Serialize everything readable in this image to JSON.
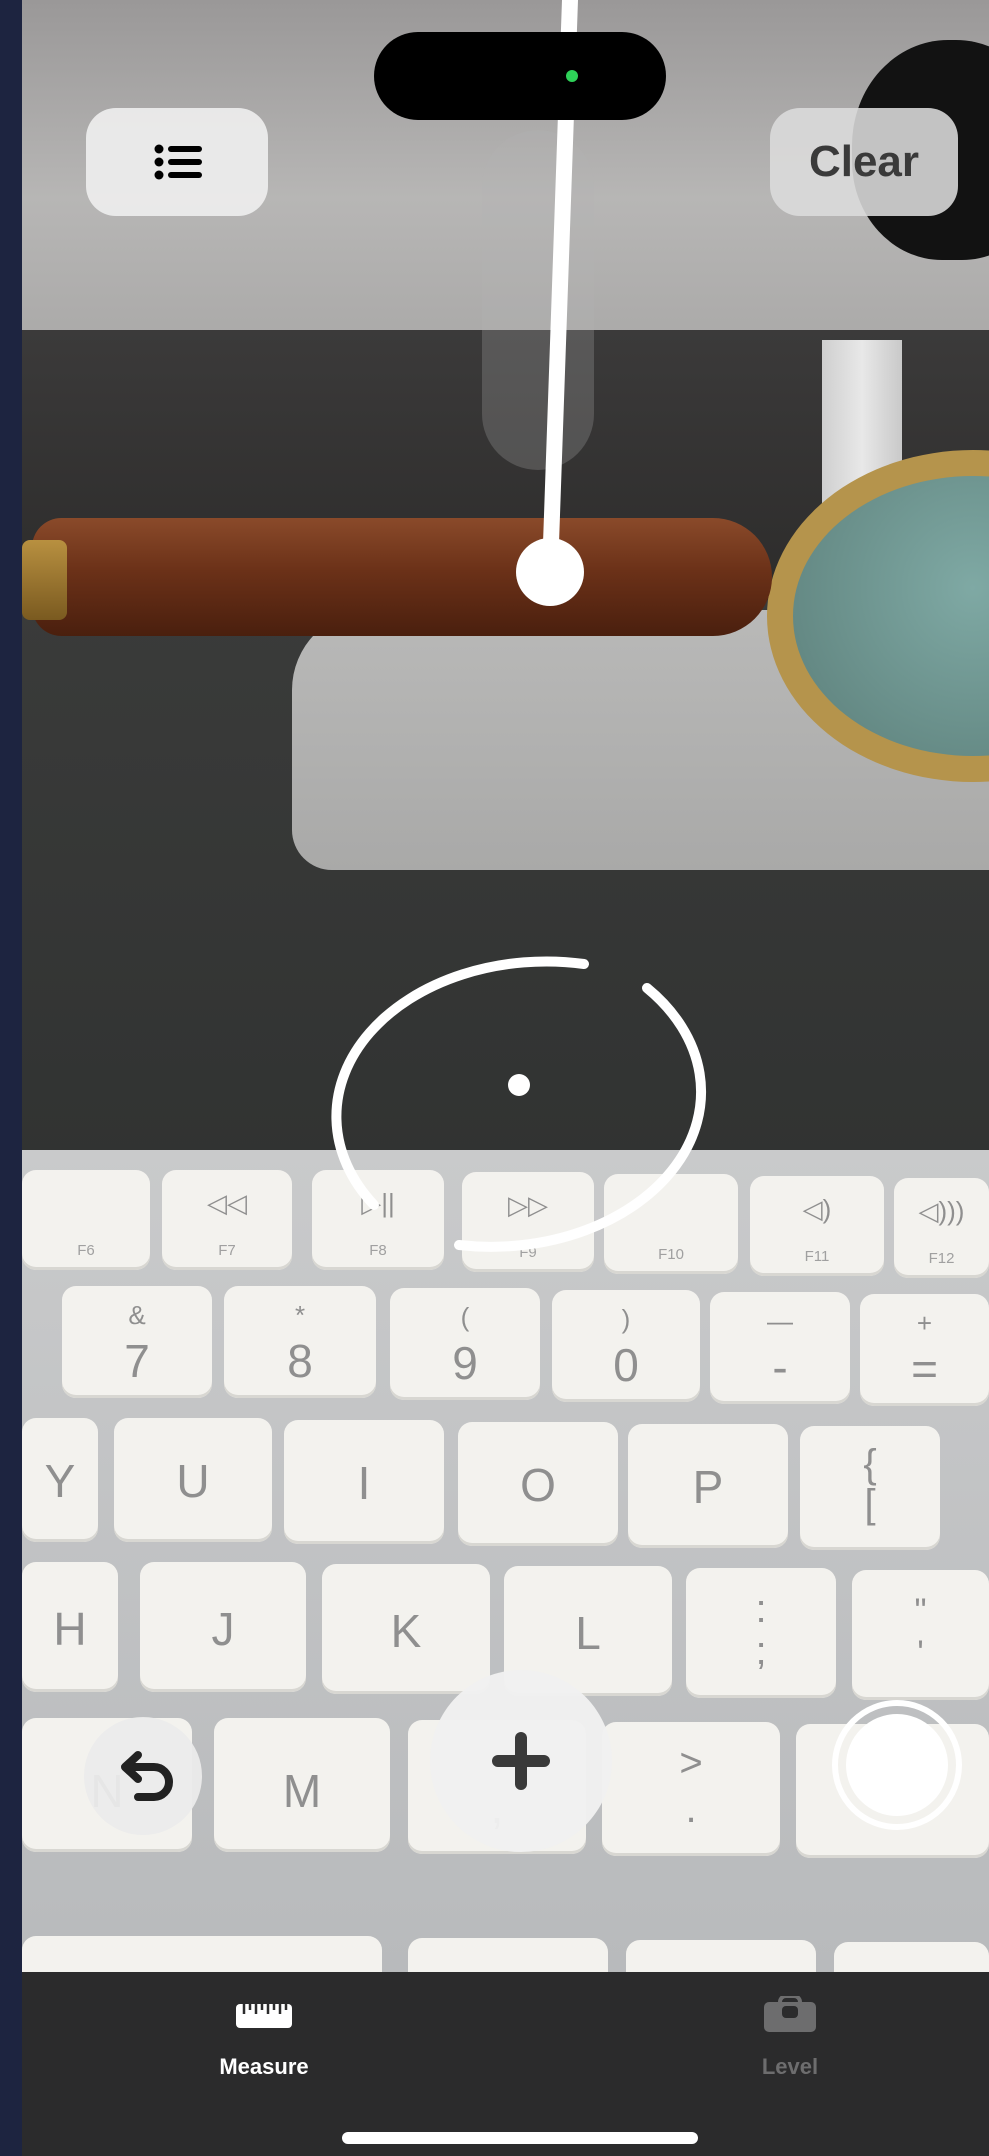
{
  "toolbar": {
    "list_icon": "list-bullet-icon",
    "clear_label": "Clear"
  },
  "status": {
    "camera_indicator_color": "#2ed158"
  },
  "reticle": {
    "icon": "focus-reticle-icon"
  },
  "keyboard": {
    "fn_row": [
      {
        "top": "",
        "bottom": "F6"
      },
      {
        "top": "◁◁",
        "bottom": "F7"
      },
      {
        "top": "▷||",
        "bottom": "F8"
      },
      {
        "top": "▷▷",
        "bottom": "F9"
      },
      {
        "top": "",
        "bottom": "F10"
      },
      {
        "top": "◁)",
        "bottom": "F11"
      },
      {
        "top": "◁)))",
        "bottom": "F12"
      }
    ],
    "num_row": [
      {
        "top": "&",
        "bottom": "7"
      },
      {
        "top": "*",
        "bottom": "8"
      },
      {
        "top": "(",
        "bottom": "9"
      },
      {
        "top": ")",
        "bottom": "0"
      },
      {
        "top": "—",
        "bottom": "-"
      },
      {
        "top": "+",
        "bottom": "="
      }
    ],
    "row_u": [
      "Y",
      "U",
      "I",
      "O",
      "P",
      "{\n["
    ],
    "row_j": [
      "H",
      "J",
      "K",
      "L",
      ":\n;",
      "\"\n'"
    ],
    "row_m": [
      "N",
      "M",
      ",",
      ">\n.",
      "/"
    ]
  },
  "controls": {
    "undo_icon": "undo-arrow-icon",
    "add_icon": "plus-icon",
    "capture_icon": "shutter-icon"
  },
  "tabs": [
    {
      "label": "Measure",
      "icon": "ruler-icon",
      "active": true
    },
    {
      "label": "Level",
      "icon": "level-icon",
      "active": false
    }
  ],
  "colors": {
    "accent": "#ffffff",
    "tab_active": "#ffffff",
    "tab_inactive": "#6d6d6e"
  }
}
